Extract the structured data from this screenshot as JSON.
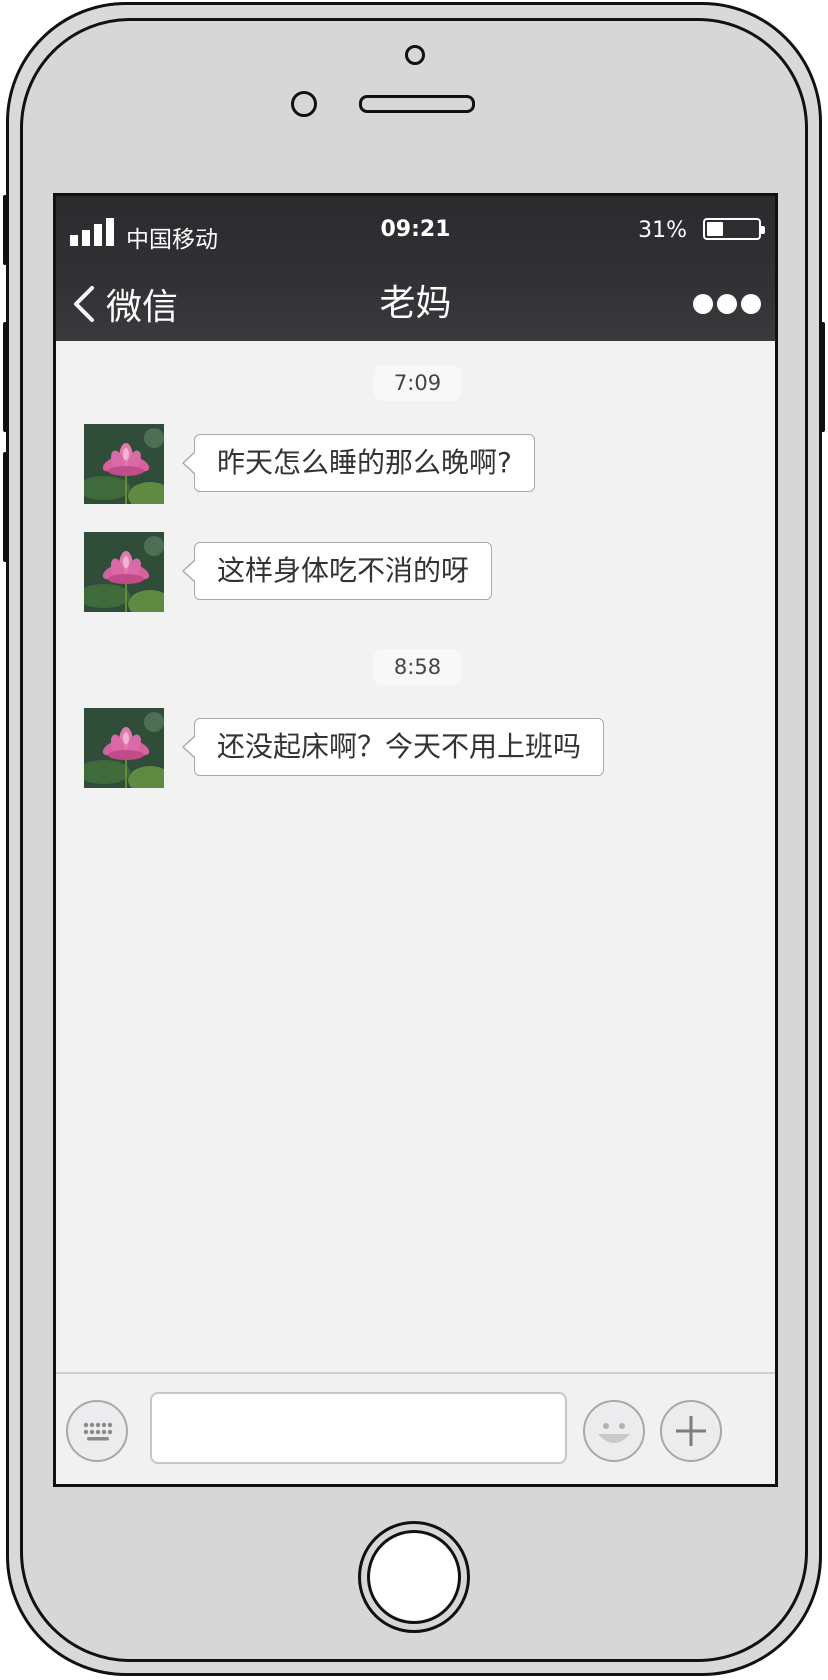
{
  "status_bar": {
    "carrier": "中国移动",
    "time": "09:21",
    "battery_percent": "31%",
    "battery_level": 0.31,
    "signal_bars": 4
  },
  "nav": {
    "back_label": "微信",
    "title": "老妈",
    "more_icon": "more-dots-icon"
  },
  "messages": [
    {
      "type": "timestamp",
      "text": "7:09"
    },
    {
      "type": "received",
      "text": "昨天怎么睡的那么晚啊?"
    },
    {
      "type": "received",
      "text": "这样身体吃不消的呀"
    },
    {
      "type": "timestamp",
      "text": "8:58"
    },
    {
      "type": "received",
      "text": "还没起床啊？今天不用上班吗"
    }
  ],
  "input_bar": {
    "left_icon": "keyboard-icon",
    "text_value": "",
    "emoji_icon": "emoji-icon",
    "plus_icon": "plus-icon"
  },
  "colors": {
    "topbar": "#333336",
    "chat_background": "#f2f2f2",
    "bubble": "#ffffff",
    "bubble_border": "#a9a9a9"
  }
}
